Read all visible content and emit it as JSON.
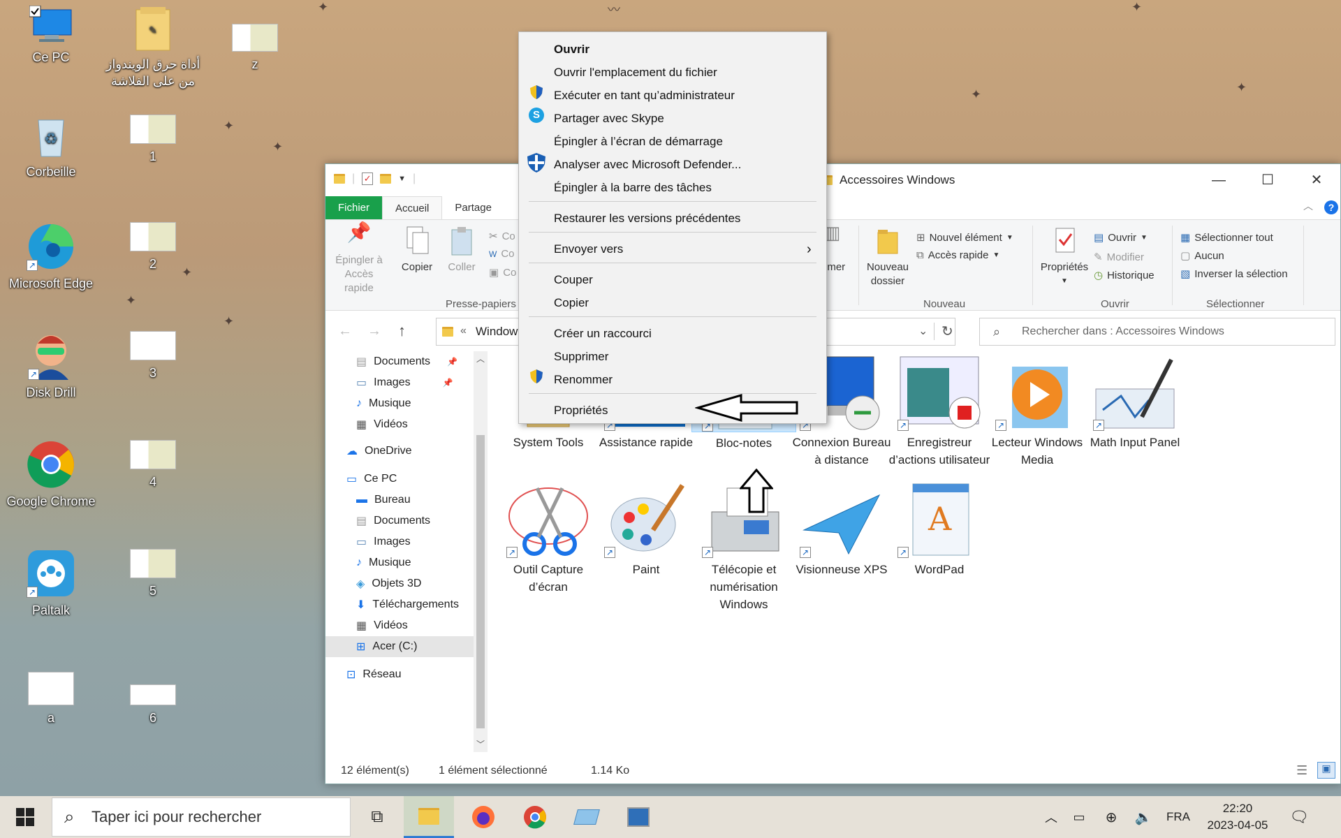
{
  "desktop": {
    "icons": [
      {
        "label": "Ce PC"
      },
      {
        "label": "أداة حرق الويندواز من على الفلاشة"
      },
      {
        "label": "z"
      },
      {
        "label": "Corbeille"
      },
      {
        "label": "1"
      },
      {
        "label": "Microsoft Edge"
      },
      {
        "label": "2"
      },
      {
        "label": "Disk Drill"
      },
      {
        "label": "3"
      },
      {
        "label": "Google Chrome"
      },
      {
        "label": "4"
      },
      {
        "label": "Paltalk"
      },
      {
        "label": "5"
      },
      {
        "label": "a"
      },
      {
        "label": "6"
      }
    ]
  },
  "explorer": {
    "title": "Accessoires Windows",
    "tabs": {
      "file": "Fichier",
      "home": "Accueil",
      "share": "Partage"
    },
    "ribbon": {
      "pin": "Épingler à Accès rapide",
      "copy": "Copier",
      "paste": "Coller",
      "cut_partial": "Co",
      "copy_path_partial": "Co",
      "paste_shortcut_partial": "Co",
      "clipboard_group": "Presse-papiers",
      "rename_partial": "mmer",
      "new_folder": "Nouveau dossier",
      "new_item": "Nouvel élément",
      "easy_access": "Accès rapide",
      "new_group": "Nouveau",
      "properties": "Propriétés",
      "open": "Ouvrir",
      "edit": "Modifier",
      "history": "Historique",
      "open_group": "Ouvrir",
      "select_all": "Sélectionner tout",
      "select_none": "Aucun",
      "invert": "Inverser la sélection",
      "select_group": "Sélectionner"
    },
    "address": {
      "path": "Window",
      "breadcrumb_prefix": "«",
      "tail": "s"
    },
    "search_placeholder": "Rechercher dans : Accessoires Windows",
    "nav": [
      {
        "label": "Documents"
      },
      {
        "label": "Images"
      },
      {
        "label": "Musique"
      },
      {
        "label": "Vidéos"
      },
      {
        "label": "OneDrive"
      },
      {
        "label": "Ce PC"
      },
      {
        "label": "Bureau"
      },
      {
        "label": "Documents"
      },
      {
        "label": "Images"
      },
      {
        "label": "Musique"
      },
      {
        "label": "Objets 3D"
      },
      {
        "label": "Téléchargements"
      },
      {
        "label": "Vidéos"
      },
      {
        "label": "Acer (C:)"
      },
      {
        "label": "Réseau"
      }
    ],
    "files": [
      {
        "label": "System Tools"
      },
      {
        "label": "Assistance rapide"
      },
      {
        "label": "Bloc-notes"
      },
      {
        "label": "Connexion Bureau à distance"
      },
      {
        "label": "Enregistreur d’actions utilisateur"
      },
      {
        "label": "Lecteur Windows Media"
      },
      {
        "label": "Math Input Panel"
      },
      {
        "label": "Outil Capture d’écran"
      },
      {
        "label": "Paint"
      },
      {
        "label": "Télécopie et numérisation Windows"
      },
      {
        "label": "Visionneuse XPS"
      },
      {
        "label": "WordPad"
      }
    ],
    "status": {
      "count": "12 élément(s)",
      "selected": "1 élément sélectionné",
      "size": "1.14 Ko"
    }
  },
  "context_menu": [
    "Ouvrir",
    "Ouvrir l'emplacement du fichier",
    "Exécuter en tant qu’administrateur",
    "Partager avec Skype",
    "Épingler à l’écran de démarrage",
    "Analyser avec Microsoft Defender...",
    "Épingler à la barre des tâches",
    "Restaurer les versions précédentes",
    "Envoyer vers",
    "Couper",
    "Copier",
    "Créer un raccourci",
    "Supprimer",
    "Renommer",
    "Propriétés"
  ],
  "taskbar": {
    "search_placeholder": "Taper ici pour rechercher",
    "lang": "FRA",
    "time": "22:20",
    "date": "2023-04-05"
  },
  "colors": {
    "file_tab": "#19a04b",
    "selection": "#cce8ff",
    "accent": "#0078d7"
  }
}
